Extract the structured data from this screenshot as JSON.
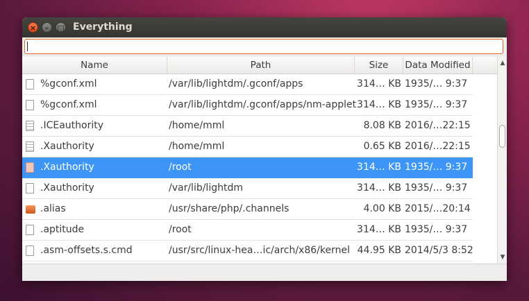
{
  "window": {
    "title": "Everything"
  },
  "search": {
    "value": "",
    "placeholder": ""
  },
  "columns": {
    "name": "Name",
    "path": "Path",
    "size": "Size",
    "date": "Data Modified"
  },
  "rows": [
    {
      "icon": "text-file-icon",
      "name": "%gconf.xml",
      "path": "/var/lib/lightdm/.gconf/apps",
      "size": "314… KB",
      "date": "1935/… 9:37",
      "selected": false
    },
    {
      "icon": "text-file-icon",
      "name": "%gconf.xml",
      "path": "/var/lib/lightdm/.gconf/apps/nm-applet",
      "size": "314… KB",
      "date": "1935/… 9:37",
      "selected": false
    },
    {
      "icon": "binary-file-icon",
      "name": ".ICEauthority",
      "path": "/home/mml",
      "size": "8.08 KB",
      "date": "2016/…22:15",
      "selected": false
    },
    {
      "icon": "binary-file-icon",
      "name": ".Xauthority",
      "path": "/home/mml",
      "size": "0.65 KB",
      "date": "2016/…22:15",
      "selected": false
    },
    {
      "icon": "file-icon",
      "name": ".Xauthority",
      "path": "/root",
      "size": "314… KB",
      "date": "1935/… 9:37",
      "selected": true
    },
    {
      "icon": "file-icon",
      "name": ".Xauthority",
      "path": "/var/lib/lightdm",
      "size": "314… KB",
      "date": "1935/… 9:37",
      "selected": false
    },
    {
      "icon": "folder-icon",
      "name": ".alias",
      "path": "/usr/share/php/.channels",
      "size": "4.00 KB",
      "date": "2015/…20:14",
      "selected": false
    },
    {
      "icon": "file-icon",
      "name": ".aptitude",
      "path": "/root",
      "size": "314… KB",
      "date": "1935/… 9:37",
      "selected": false
    },
    {
      "icon": "file-icon",
      "name": ".asm-offsets.s.cmd",
      "path": "/usr/src/linux-hea…ic/arch/x86/kernel",
      "size": "44.95 KB",
      "date": "2014/5/3 8:52",
      "selected": false
    }
  ],
  "icons": {
    "close": "×",
    "minimize": "–",
    "maximize": "□",
    "scroll_up": "▲",
    "scroll_down": "▼"
  },
  "colors": {
    "selection": "#3d96f5",
    "search_border": "#e0652b",
    "close_button": "#df4a1b"
  }
}
